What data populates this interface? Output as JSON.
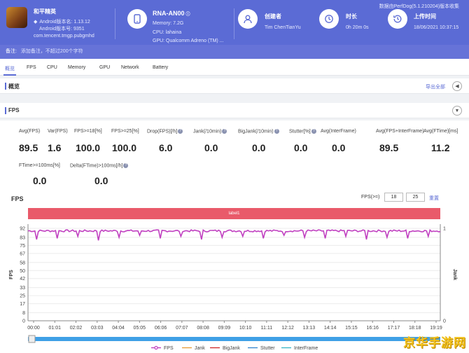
{
  "app": {
    "name": "和平精英",
    "android_version_name": "Android版本名: 1.13.12",
    "android_version_code": "Android版本号: 9351",
    "package": "com.tencent.tmgp.pubgmhd"
  },
  "device": {
    "name": "RNA-AN00",
    "memory": "Memory: 7.2G",
    "cpu": "CPU: lahaina",
    "gpu": "GPU: Qualcomm Adreno (TM) ..."
  },
  "creator": {
    "label": "创建者",
    "value": "Tim ChenTianYu"
  },
  "duration": {
    "label": "时长",
    "value": "0h 20m 0s"
  },
  "upload": {
    "label": "上传时间",
    "value": "18/06/2021 10:37:15"
  },
  "version_info": "数据由PerfDog(5.1.210204)版本收集",
  "note": {
    "label": "备注:",
    "placeholder": "添加备注，不超过200个字符"
  },
  "tabs": [
    "概览",
    "FPS",
    "CPU",
    "Memory",
    "GPU",
    "Network",
    "Battery"
  ],
  "overview": {
    "title": "概览",
    "export_label": "导出全部",
    "toggle": "◀"
  },
  "fps_section": {
    "title": "FPS",
    "toggle": "▼"
  },
  "metrics": [
    {
      "label": "Avg(FPS)",
      "value": "89.5",
      "help": false
    },
    {
      "label": "Var(FPS)",
      "value": "1.6",
      "help": false
    },
    {
      "label": "FPS>=18[%]",
      "value": "100.0",
      "help": false
    },
    {
      "label": "FPS>=25[%]",
      "value": "100.0",
      "help": false
    },
    {
      "label": "Drop(FPS)[/h]",
      "value": "6.0",
      "help": true
    },
    {
      "label": "Jank(/10min)",
      "value": "0.0",
      "help": true
    },
    {
      "label": "BigJank(/10min)",
      "value": "0.0",
      "help": true
    },
    {
      "label": "Stutter[%]",
      "value": "0.0",
      "help": true
    },
    {
      "label": "Avg(InterFrame)",
      "value": "0.0",
      "help": false
    },
    {
      "label": "Avg(FPS+InterFrame)",
      "value": "89.5",
      "help": false
    },
    {
      "label": "Avg(FTime)[ms]",
      "value": "11.2",
      "help": false
    },
    {
      "label": "FTime>=100ms[%]",
      "value": "0.0",
      "help": false
    },
    {
      "label": "Delta(FTime)>100ms[/h]",
      "value": "0.0",
      "help": true
    }
  ],
  "chart_controls": {
    "title": "FPS",
    "threshold_label": "FPS(>=)",
    "threshold1": "18",
    "threshold2": "25",
    "reset_label": "重置",
    "band_label": "label1"
  },
  "chart_data": {
    "type": "line",
    "ylabel": "FPS",
    "y2label": "Jank",
    "ylim": [
      0,
      92
    ],
    "yticks": [
      0,
      8,
      17,
      25,
      33,
      42,
      50,
      58,
      67,
      75,
      83,
      92
    ],
    "y2lim": [
      0,
      1
    ],
    "y2ticks": [
      0,
      1
    ],
    "xticks": [
      "00:00",
      "01:01",
      "02:02",
      "03:03",
      "04:04",
      "05:05",
      "06:06",
      "07:07",
      "08:08",
      "09:09",
      "10:10",
      "11:11",
      "12:12",
      "13:13",
      "14:14",
      "15:15",
      "16:16",
      "17:17",
      "18:18",
      "19:19"
    ],
    "series": [
      {
        "name": "FPS",
        "color": "#c040c0",
        "baseline": 89.5,
        "dips": [
          81,
          82,
          84,
          80,
          83,
          85,
          82,
          84,
          81,
          83,
          84,
          82,
          85,
          83,
          82,
          84,
          81,
          83,
          82,
          84,
          83
        ]
      },
      {
        "name": "Jank",
        "color": "#e8a040",
        "values": []
      },
      {
        "name": "BigJank",
        "color": "#d03030",
        "values": []
      },
      {
        "name": "Stutter",
        "color": "#3a8ad0",
        "values": []
      },
      {
        "name": "InterFrame",
        "color": "#40b8c8",
        "values": []
      }
    ],
    "grid": true,
    "legend": "bottom"
  },
  "watermark": "京华手游网"
}
